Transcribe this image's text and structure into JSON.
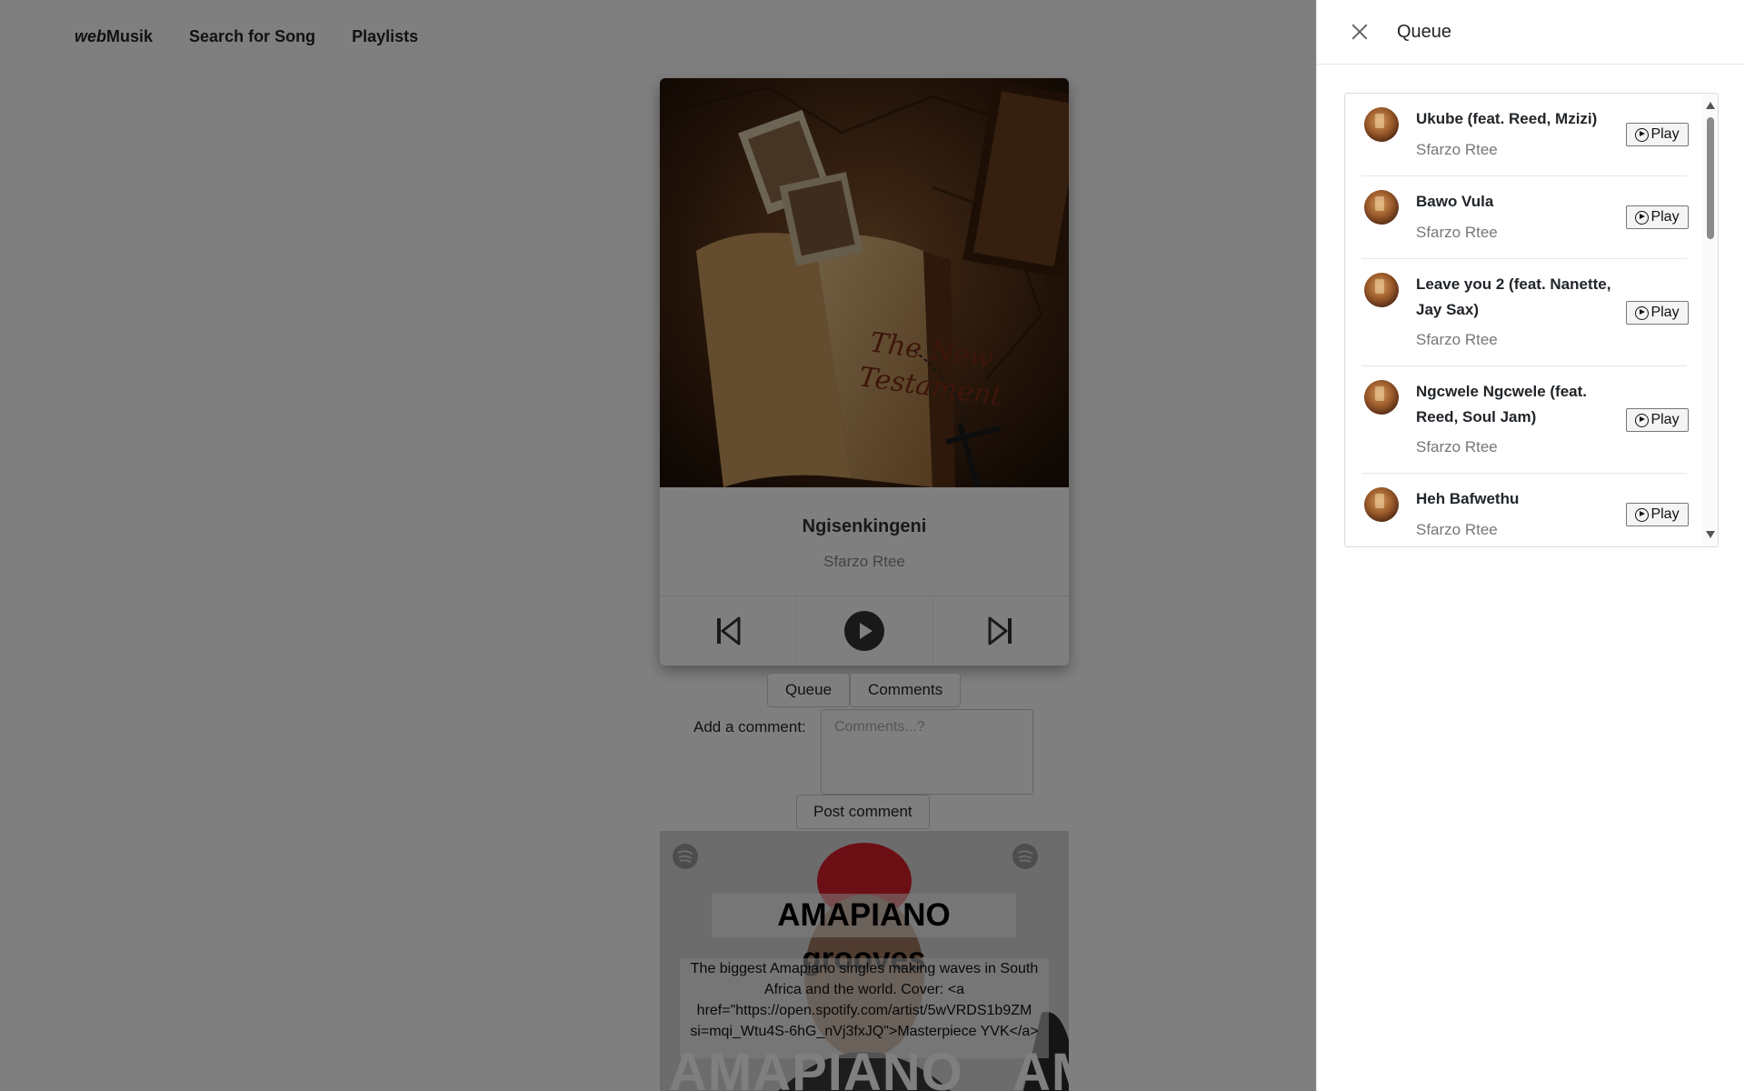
{
  "nav": {
    "brand_italic": "web",
    "brand_rest": "Musik",
    "links": [
      "Search for Song",
      "Playlists"
    ]
  },
  "player": {
    "title": "Ngisenkingeni",
    "artist": "Sfarzo Rtee",
    "controls": [
      "previous-icon",
      "play-icon",
      "next-icon"
    ]
  },
  "tabs": [
    "Queue",
    "Comments"
  ],
  "comments": {
    "label": "Add a comment:",
    "placeholder": "Comments...?",
    "post_label": "Post comment"
  },
  "playlist": {
    "title": "AMAPIANO grooves",
    "description": "The biggest Amapiano singles making waves in South Africa and the world. Cover: <a href=\"https://open.spotify.com/artist/5wVRDS1b9ZM si=mqi_Wtu4S-6hG_nVj3fxJQ\">Masterpiece YVK</a>",
    "big_text_1": "AMAPIANO",
    "big_text_2": "AM"
  },
  "drawer": {
    "title": "Queue",
    "play_label": "Play",
    "items": [
      {
        "title": "Ukube (feat. Reed, Mzizi)",
        "artist": "Sfarzo Rtee"
      },
      {
        "title": "Bawo Vula",
        "artist": "Sfarzo Rtee"
      },
      {
        "title": "Leave you 2 (feat. Nanette, Jay Sax)",
        "artist": "Sfarzo Rtee"
      },
      {
        "title": "Ngcwele Ngcwele (feat. Reed, Soul Jam)",
        "artist": "Sfarzo Rtee"
      },
      {
        "title": "Heh Bafwethu",
        "artist": "Sfarzo Rtee"
      }
    ]
  }
}
